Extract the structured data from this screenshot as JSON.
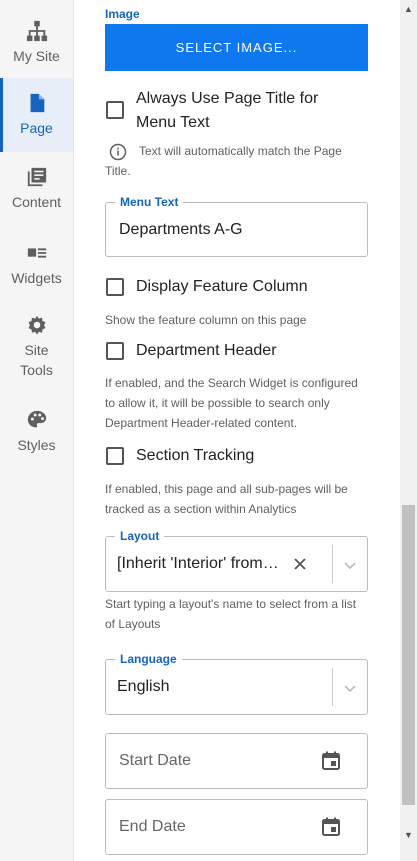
{
  "nav": {
    "items": [
      {
        "label": "My Site",
        "icon": "sitemap-icon"
      },
      {
        "label": "Page",
        "icon": "page-icon"
      },
      {
        "label": "Content",
        "icon": "content-icon"
      },
      {
        "label": "Widgets",
        "icon": "widgets-icon"
      },
      {
        "label": "Site Tools",
        "icon": "gear-icon"
      },
      {
        "label": "Styles",
        "icon": "palette-icon"
      }
    ],
    "active": "Page"
  },
  "image": {
    "label": "Image",
    "button": "SELECT IMAGE..."
  },
  "always_use_title": {
    "label": "Always Use Page Title for Menu Text",
    "help": "Text will automatically match the Page Title.",
    "checked": false
  },
  "menu_text": {
    "label": "Menu Text",
    "value": "Departments A-G"
  },
  "feature_column": {
    "label": "Display Feature Column",
    "help": "Show the feature column on this page",
    "checked": false
  },
  "department_header": {
    "label": "Department Header",
    "help": "If enabled, and the Search Widget is configured to allow it, it will be possible to search only Department Header-related content.",
    "checked": false
  },
  "section_tracking": {
    "label": "Section Tracking",
    "help": "If enabled, this page and all sub-pages will be tracked as a section within Analytics",
    "checked": false
  },
  "layout": {
    "label": "Layout",
    "value": "[Inherit 'Interior' from…",
    "help": "Start typing a layout's name to select from a list of Layouts"
  },
  "language": {
    "label": "Language",
    "value": "English"
  },
  "start_date": {
    "placeholder": "Start Date"
  },
  "end_date": {
    "placeholder": "End Date"
  },
  "colors": {
    "accent": "#1565c0",
    "button": "#0f78ef"
  }
}
